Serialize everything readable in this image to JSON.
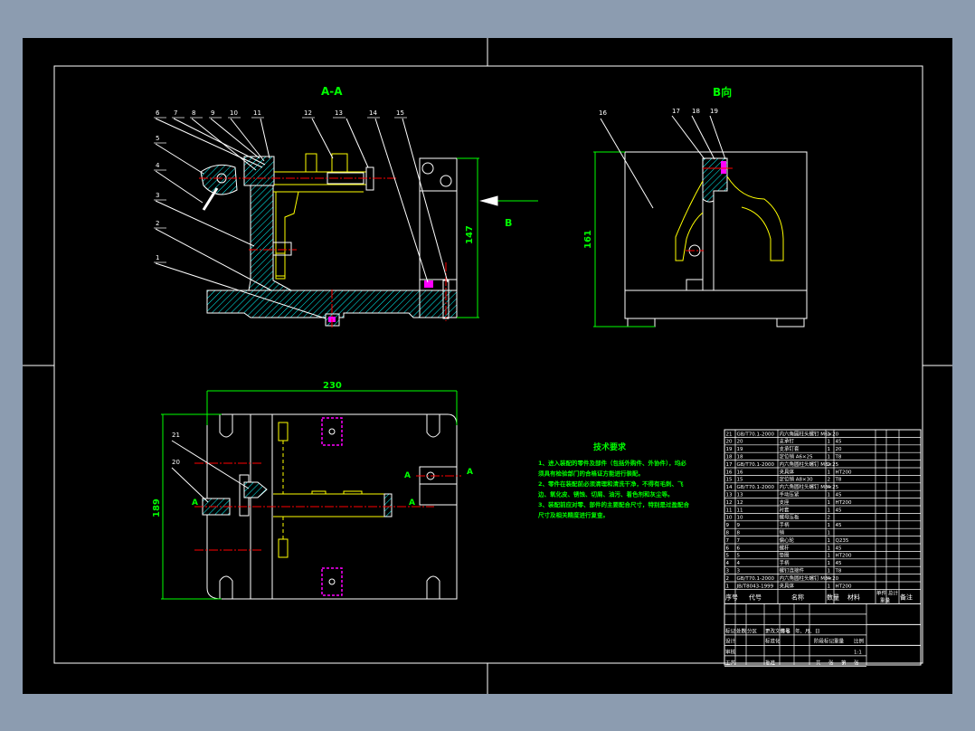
{
  "colors": {
    "background": "#8c9cb0",
    "paper": "#000000",
    "outline": "#ffffff",
    "part": "#ffff00",
    "centerline": "#ff0000",
    "dimension": "#00ff00",
    "hatch": "#00ffff"
  },
  "views": {
    "section_title": "A-A",
    "view_b_title": "B向",
    "view_b_arrow_label": "B",
    "section_marker": "A"
  },
  "dimensions": {
    "height_section": "147",
    "height_view_b": "161",
    "plan_width": "230",
    "plan_height": "189"
  },
  "balloons_section": [
    "6",
    "7",
    "8",
    "9",
    "10",
    "11",
    "12",
    "13",
    "14",
    "15",
    "5",
    "4",
    "3",
    "2",
    "1"
  ],
  "balloons_view_b": [
    "16",
    "17",
    "18",
    "19"
  ],
  "balloons_plan": [
    "21",
    "20"
  ],
  "tech_requirements": {
    "title": "技术要求",
    "lines": [
      "1、进入装配的零件及部件（包括外购件、外协件），均必",
      "须具有检验部门的合格证方能进行装配。",
      "2、零件在装配前必须清理和清洗干净，不得有毛刺、飞",
      "边、氧化皮、锈蚀、切屑、油污、着色剂和灰尘等。",
      "3、装配前应对零、部件的主要配合尺寸，特别是过盈配合",
      "尺寸及相关精度进行复查。"
    ]
  },
  "parts_list": {
    "headers": [
      "序号",
      "代号",
      "名称",
      "数量",
      "材料",
      "单件",
      "总计",
      "备注"
    ],
    "weight_header": "重量",
    "rows": [
      [
        "21",
        "GB/T70.1-2000",
        "内六角圆柱头螺钉 M6×20",
        "1",
        ""
      ],
      [
        "20",
        "20",
        "支承钉",
        "1",
        "45"
      ],
      [
        "19",
        "19",
        "支承钉套",
        "1",
        "20"
      ],
      [
        "18",
        "18",
        "定位销 A6×25",
        "1",
        "T8"
      ],
      [
        "17",
        "GB/T70.1-2000",
        "内六角圆柱头螺钉 M8×25",
        "2",
        ""
      ],
      [
        "16",
        "16",
        "夹具体",
        "1",
        "HT200"
      ],
      [
        "15",
        "15",
        "定位销 A8×30",
        "2",
        "T8"
      ],
      [
        "14",
        "GB/T70.1-2000",
        "内六角圆柱头螺钉 M8×25",
        "4",
        ""
      ],
      [
        "13",
        "13",
        "手动压紧",
        "1",
        "45"
      ],
      [
        "12",
        "12",
        "支座",
        "1",
        "HT200"
      ],
      [
        "11",
        "11",
        "衬套",
        "1",
        "45"
      ],
      [
        "10",
        "10",
        "螺母压板",
        "2",
        ""
      ],
      [
        "9",
        "9",
        "手柄",
        "1",
        "45"
      ],
      [
        "8",
        "8",
        "销",
        "1",
        ""
      ],
      [
        "7",
        "7",
        "偏心轮",
        "1",
        "Q235"
      ],
      [
        "6",
        "6",
        "螺杆",
        "1",
        "45"
      ],
      [
        "5",
        "5",
        "垫圈",
        "1",
        "HT200"
      ],
      [
        "4",
        "4",
        "手柄",
        "1",
        "45"
      ],
      [
        "3",
        "3",
        "螺钉连接件",
        "1",
        "T8"
      ],
      [
        "2",
        "GB/T70.1-2000",
        "内六角圆柱头螺钉 M8×20",
        "4",
        ""
      ],
      [
        "1",
        "JB/T8043-1999",
        "夹具体",
        "1",
        "HT200"
      ]
    ]
  },
  "title_block": {
    "revision_headers": [
      "标记",
      "处数",
      "分区",
      "更改文件号",
      "签名",
      "年、月、日"
    ],
    "design": "设计",
    "standardization": "标准化",
    "review": "审核",
    "process": "工艺",
    "approve": "批准",
    "stage_headers": [
      "阶段标记",
      "重量",
      "比例"
    ],
    "scale": "1:1",
    "sheet": [
      "共",
      "张",
      "第",
      "张"
    ]
  }
}
